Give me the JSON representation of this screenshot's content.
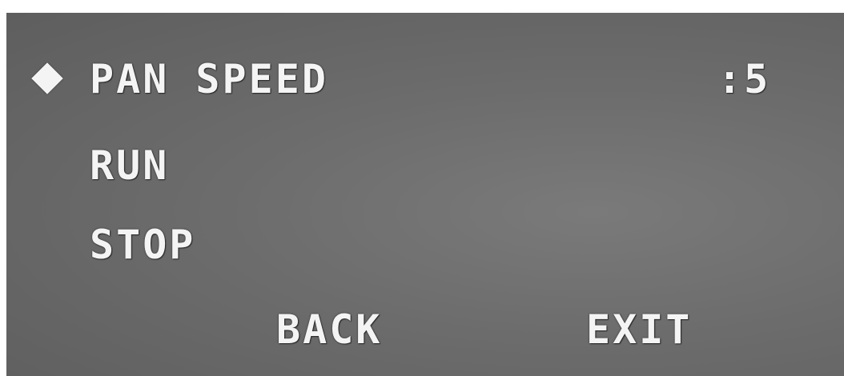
{
  "menu": {
    "cursor_icon": "diamond-cursor-icon",
    "pan_speed": {
      "label": "PAN SPEED",
      "value": ":5"
    },
    "run_label": "RUN",
    "stop_label": "STOP"
  },
  "footer": {
    "back_label": "BACK",
    "exit_label": "EXIT"
  },
  "colors": {
    "text": "#f4f4f4",
    "background": "#6c6c6c"
  }
}
